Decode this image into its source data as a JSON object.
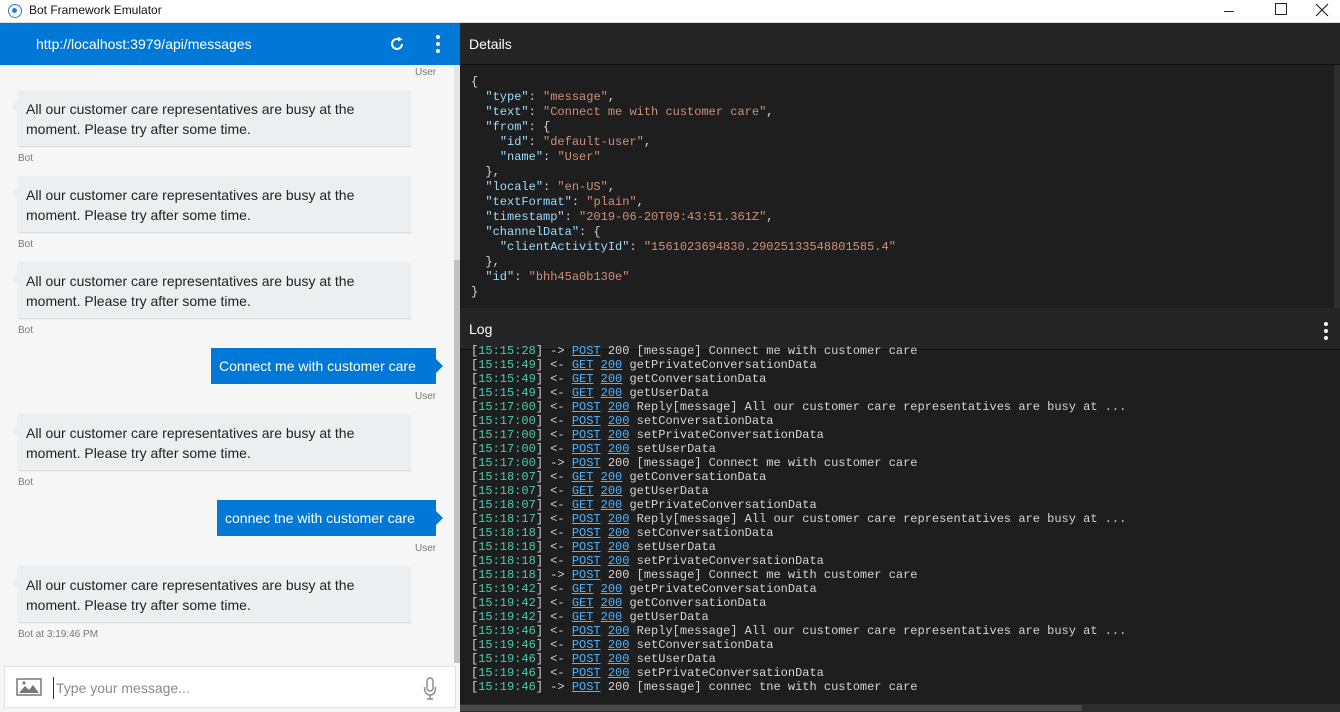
{
  "window": {
    "title": "Bot Framework Emulator"
  },
  "chat": {
    "endpoint_url": "http://localhost:3979/api/messages",
    "top_label": "User",
    "messages": [
      {
        "role": "bot",
        "text": "All our customer care representatives are busy at the moment. Please try after some time.",
        "label": "Bot"
      },
      {
        "role": "bot",
        "text": "All our customer care representatives are busy at the moment. Please try after some time.",
        "label": "Bot"
      },
      {
        "role": "bot",
        "text": "All our customer care representatives are busy at the moment. Please try after some time.",
        "label": "Bot"
      },
      {
        "role": "user",
        "text": "Connect me with customer care",
        "label": "User"
      },
      {
        "role": "bot",
        "text": "All our customer care representatives are busy at the moment. Please try after some time.",
        "label": "Bot"
      },
      {
        "role": "user",
        "text": "connec tne with customer care",
        "label": "User"
      },
      {
        "role": "bot",
        "text": "All our customer care representatives are busy at the moment. Please try after some time.",
        "label": "Bot at 3:19:46 PM"
      }
    ],
    "input_placeholder": "Type your message..."
  },
  "details": {
    "title": "Details",
    "json": {
      "type": "message",
      "text": "Connect me with customer care",
      "from_id": "default-user",
      "from_name": "User",
      "locale": "en-US",
      "textFormat": "plain",
      "timestamp": "2019-06-20T09:43:51.361Z",
      "clientActivityId": "1561023694830.29025133548801585.4",
      "id": "bhh45a0b130e"
    }
  },
  "log": {
    "title": "Log",
    "entries": [
      {
        "time": "[15:15:28]",
        "dir": "->",
        "method": "POST",
        "code": "200",
        "code_link": false,
        "text": "[message] Connect me with customer care"
      },
      {
        "time": "[15:15:49]",
        "dir": "<-",
        "method": "GET",
        "code": "200",
        "code_link": true,
        "text": "getPrivateConversationData"
      },
      {
        "time": "[15:15:49]",
        "dir": "<-",
        "method": "GET",
        "code": "200",
        "code_link": true,
        "text": "getConversationData"
      },
      {
        "time": "[15:15:49]",
        "dir": "<-",
        "method": "GET",
        "code": "200",
        "code_link": true,
        "text": "getUserData"
      },
      {
        "time": "[15:17:00]",
        "dir": "<-",
        "method": "POST",
        "code": "200",
        "code_link": true,
        "text": "Reply[message] All our customer care representatives are busy at ..."
      },
      {
        "time": "[15:17:00]",
        "dir": "<-",
        "method": "POST",
        "code": "200",
        "code_link": true,
        "text": "setConversationData"
      },
      {
        "time": "[15:17:00]",
        "dir": "<-",
        "method": "POST",
        "code": "200",
        "code_link": true,
        "text": "setPrivateConversationData"
      },
      {
        "time": "[15:17:00]",
        "dir": "<-",
        "method": "POST",
        "code": "200",
        "code_link": true,
        "text": "setUserData"
      },
      {
        "time": "[15:17:00]",
        "dir": "->",
        "method": "POST",
        "code": "200",
        "code_link": false,
        "text": "[message] Connect me with customer care"
      },
      {
        "time": "[15:18:07]",
        "dir": "<-",
        "method": "GET",
        "code": "200",
        "code_link": true,
        "text": "getConversationData"
      },
      {
        "time": "[15:18:07]",
        "dir": "<-",
        "method": "GET",
        "code": "200",
        "code_link": true,
        "text": "getUserData"
      },
      {
        "time": "[15:18:07]",
        "dir": "<-",
        "method": "GET",
        "code": "200",
        "code_link": true,
        "text": "getPrivateConversationData"
      },
      {
        "time": "[15:18:17]",
        "dir": "<-",
        "method": "POST",
        "code": "200",
        "code_link": true,
        "text": "Reply[message] All our customer care representatives are busy at ..."
      },
      {
        "time": "[15:18:18]",
        "dir": "<-",
        "method": "POST",
        "code": "200",
        "code_link": true,
        "text": "setConversationData"
      },
      {
        "time": "[15:18:18]",
        "dir": "<-",
        "method": "POST",
        "code": "200",
        "code_link": true,
        "text": "setUserData"
      },
      {
        "time": "[15:18:18]",
        "dir": "<-",
        "method": "POST",
        "code": "200",
        "code_link": true,
        "text": "setPrivateConversationData"
      },
      {
        "time": "[15:18:18]",
        "dir": "->",
        "method": "POST",
        "code": "200",
        "code_link": false,
        "text": "[message] Connect me with customer care"
      },
      {
        "time": "[15:19:42]",
        "dir": "<-",
        "method": "GET",
        "code": "200",
        "code_link": true,
        "text": "getPrivateConversationData"
      },
      {
        "time": "[15:19:42]",
        "dir": "<-",
        "method": "GET",
        "code": "200",
        "code_link": true,
        "text": "getConversationData"
      },
      {
        "time": "[15:19:42]",
        "dir": "<-",
        "method": "GET",
        "code": "200",
        "code_link": true,
        "text": "getUserData"
      },
      {
        "time": "[15:19:46]",
        "dir": "<-",
        "method": "POST",
        "code": "200",
        "code_link": true,
        "text": "Reply[message] All our customer care representatives are busy at ..."
      },
      {
        "time": "[15:19:46]",
        "dir": "<-",
        "method": "POST",
        "code": "200",
        "code_link": true,
        "text": "setConversationData"
      },
      {
        "time": "[15:19:46]",
        "dir": "<-",
        "method": "POST",
        "code": "200",
        "code_link": true,
        "text": "setUserData"
      },
      {
        "time": "[15:19:46]",
        "dir": "<-",
        "method": "POST",
        "code": "200",
        "code_link": true,
        "text": "setPrivateConversationData"
      },
      {
        "time": "[15:19:46]",
        "dir": "->",
        "method": "POST",
        "code": "200",
        "code_link": false,
        "text": "[message] connec tne with customer care"
      }
    ]
  }
}
